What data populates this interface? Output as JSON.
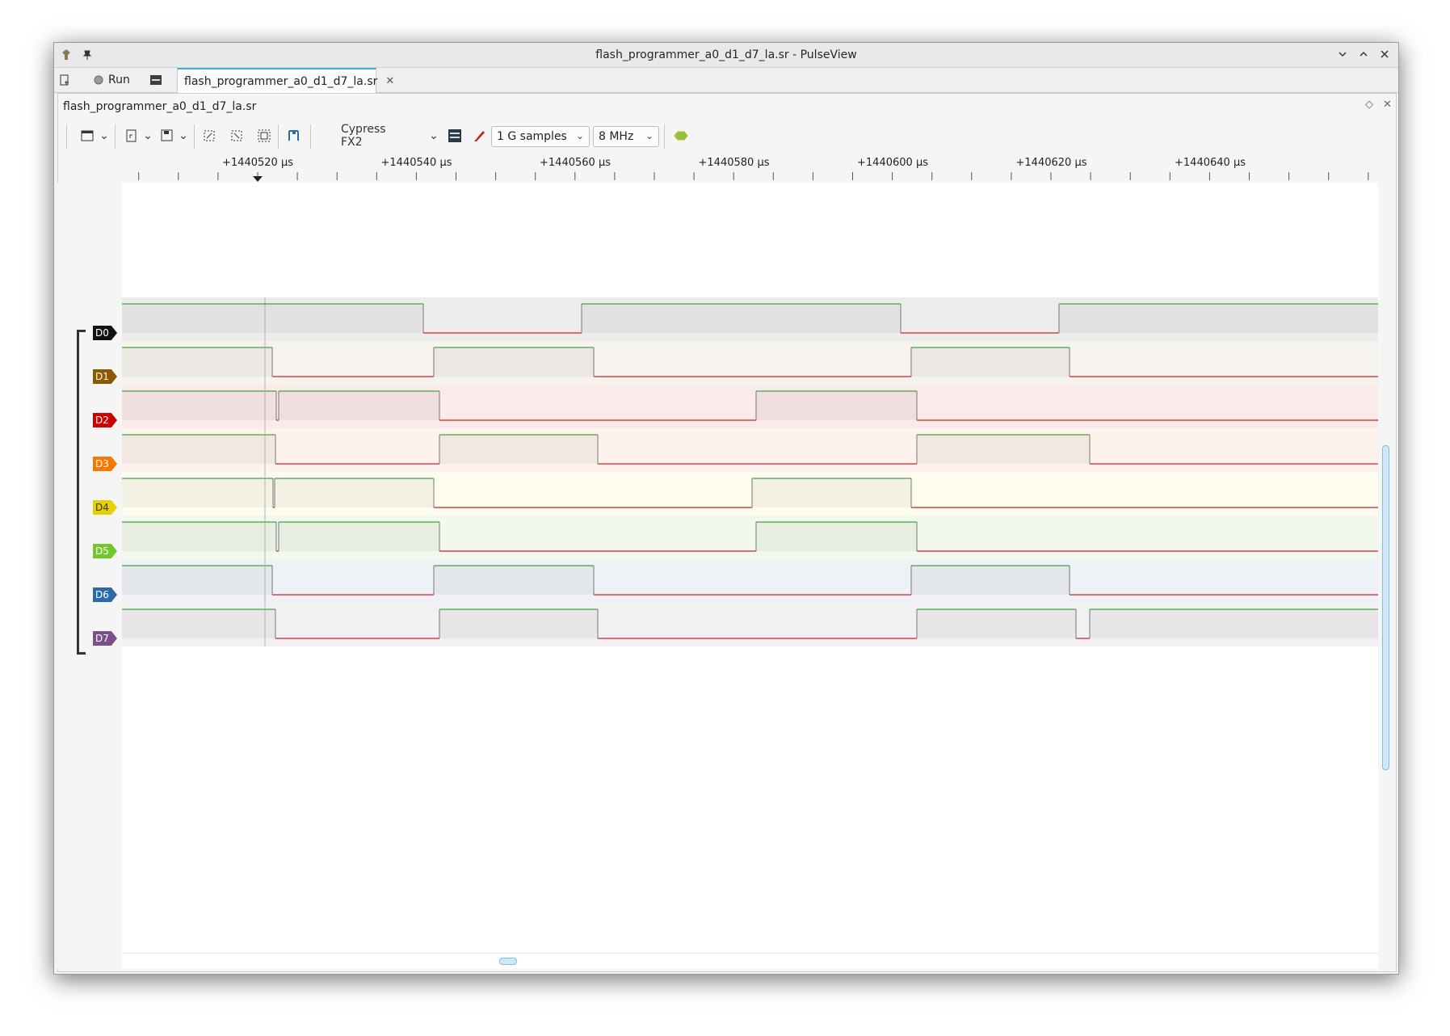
{
  "window": {
    "title": "flash_programmer_a0_d1_d7_la.sr - PulseView",
    "controls": [
      "chevron-down-icon",
      "chevron-up-icon",
      "close-icon"
    ]
  },
  "tabs": {
    "new_icon": "new-session-icon",
    "run_label": "Run",
    "session_label": "flash_programmer_a0_d1_d7_la.sr"
  },
  "dock": {
    "title": "flash_programmer_a0_d1_d7_la.sr"
  },
  "toolbar": {
    "device": "Cypress FX2",
    "samples": "1 G samples",
    "rate": "8 MHz"
  },
  "ruler": {
    "labels": [
      "+1440520 µs",
      "+1440540 µs",
      "+1440560 µs",
      "+1440580 µs",
      "+1440600 µs",
      "+1440620 µs",
      "+1440640 µs"
    ]
  },
  "channels": [
    {
      "name": "D0",
      "color": "#111111",
      "bg": "#ececec",
      "trace": [
        [
          0,
          1
        ],
        [
          373,
          0
        ],
        [
          569,
          1
        ],
        [
          964,
          0
        ],
        [
          1160,
          1
        ]
      ]
    },
    {
      "name": "D1",
      "color": "#8b5a00",
      "bg": "#f6f2ee",
      "trace": [
        [
          0,
          1
        ],
        [
          186,
          0
        ],
        [
          386,
          1
        ],
        [
          584,
          0
        ],
        [
          977,
          1
        ],
        [
          1173,
          0
        ]
      ]
    },
    {
      "name": "D2",
      "color": "#cc0000",
      "bg": "#fbeaea",
      "trace": [
        [
          0,
          1
        ],
        [
          191,
          0
        ],
        [
          194,
          1
        ],
        [
          393,
          0
        ],
        [
          785,
          1
        ],
        [
          984,
          0
        ]
      ]
    },
    {
      "name": "D3",
      "color": "#f57900",
      "bg": "#fdf3ec",
      "trace": [
        [
          0,
          1
        ],
        [
          190,
          0
        ],
        [
          393,
          1
        ],
        [
          589,
          0
        ],
        [
          984,
          1
        ],
        [
          1198,
          0
        ]
      ]
    },
    {
      "name": "D4",
      "color": "#e8d000",
      "bg": "#fefcee",
      "trace": [
        [
          0,
          1
        ],
        [
          187,
          0
        ],
        [
          189,
          1
        ],
        [
          386,
          0
        ],
        [
          780,
          1
        ],
        [
          977,
          0
        ]
      ]
    },
    {
      "name": "D5",
      "color": "#73c62e",
      "bg": "#f2f8ec",
      "trace": [
        [
          0,
          1
        ],
        [
          191,
          0
        ],
        [
          194,
          1
        ],
        [
          393,
          0
        ],
        [
          785,
          1
        ],
        [
          984,
          0
        ]
      ]
    },
    {
      "name": "D6",
      "color": "#2d6aab",
      "bg": "#eef1f5",
      "trace": [
        [
          0,
          1
        ],
        [
          186,
          0
        ],
        [
          386,
          1
        ],
        [
          584,
          0
        ],
        [
          977,
          1
        ],
        [
          1173,
          0
        ]
      ]
    },
    {
      "name": "D7",
      "color": "#7a4f8a",
      "bg": "#f3f0f4",
      "trace": [
        [
          0,
          1
        ],
        [
          190,
          0
        ],
        [
          393,
          1
        ],
        [
          589,
          0
        ],
        [
          984,
          1
        ],
        [
          1181,
          0
        ],
        [
          1198,
          1
        ]
      ]
    }
  ],
  "colors": {
    "high": "#3aa83a",
    "low": "#cc2222",
    "cursor": "#b0b0b0"
  }
}
